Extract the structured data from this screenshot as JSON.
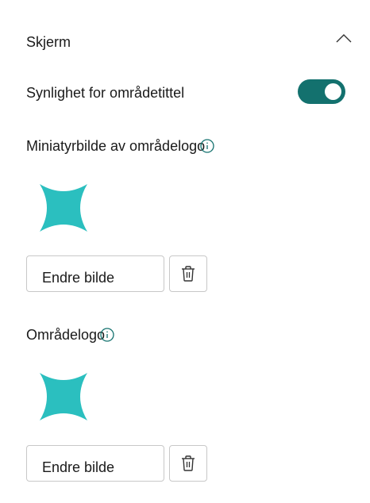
{
  "section": {
    "title": "Skjerm",
    "collapse_icon": "chevron-up-icon"
  },
  "title_visibility": {
    "label": "Synlighet for områdetittel",
    "enabled": true,
    "accent_color": "#13716e"
  },
  "thumbnail_logo": {
    "label": "Miniatyrbilde av områdelogo",
    "info_icon": "info-icon",
    "image_icon": "four-point-star-icon",
    "image_color": "#2bbfbf",
    "change_button_label": "Endre bilde",
    "delete_icon": "trash-icon"
  },
  "site_logo": {
    "label": "Områdelogo",
    "info_icon": "info-icon",
    "image_icon": "four-point-star-icon",
    "image_color": "#2bbfbf",
    "change_button_label": "Endre bilde",
    "delete_icon": "trash-icon"
  }
}
